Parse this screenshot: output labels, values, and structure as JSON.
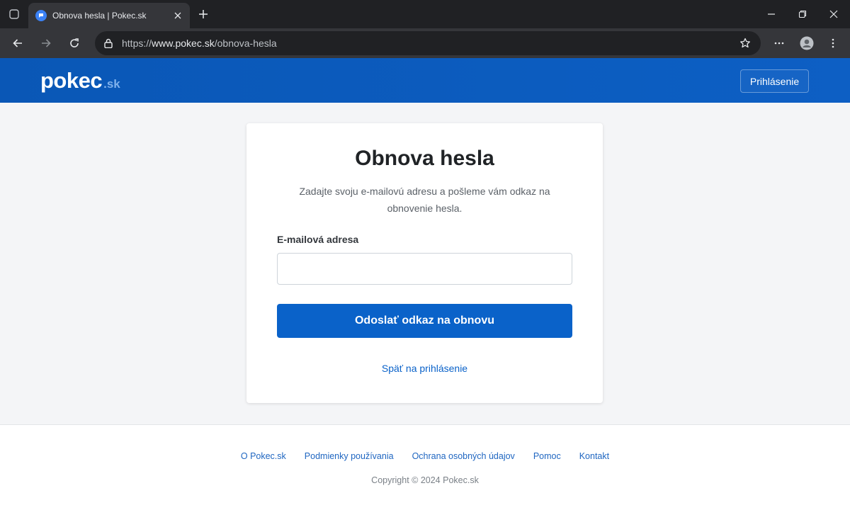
{
  "browser": {
    "tab_title": "Obnova hesla | Pokec.sk",
    "url_scheme": "https://",
    "url_host": "www.pokec.sk",
    "url_path": "/obnova-hesla"
  },
  "header": {
    "logo_main": "pokec",
    "logo_suffix": ".sk",
    "login_label": "Prihlásenie"
  },
  "form": {
    "title": "Obnova hesla",
    "description": "Zadajte svoju e-mailovú adresu a pošleme vám odkaz na obnovenie hesla.",
    "email_label": "E-mailová adresa",
    "email_value": "",
    "submit_label": "Odoslať odkaz na obnovu",
    "back_link": "Späť na prihlásenie"
  },
  "footer": {
    "links": [
      "O Pokec.sk",
      "Podmienky používania",
      "Ochrana osobných údajov",
      "Pomoc",
      "Kontakt"
    ],
    "copyright": "Copyright © 2024 Pokec.sk"
  },
  "colors": {
    "brand_blue": "#0a57b6",
    "button_blue": "#0a62c9",
    "link_blue": "#1f66c1"
  },
  "icons": {
    "tab_switcher": "tab-switcher-icon",
    "favicon": "pokec-favicon-icon",
    "back": "arrow-left-icon",
    "forward": "arrow-right-icon",
    "reload": "reload-icon",
    "lock": "lock-icon",
    "bookmark": "star-icon",
    "menu": "more-horizontal-icon",
    "profile": "profile-icon",
    "kebab": "more-vertical-icon"
  }
}
